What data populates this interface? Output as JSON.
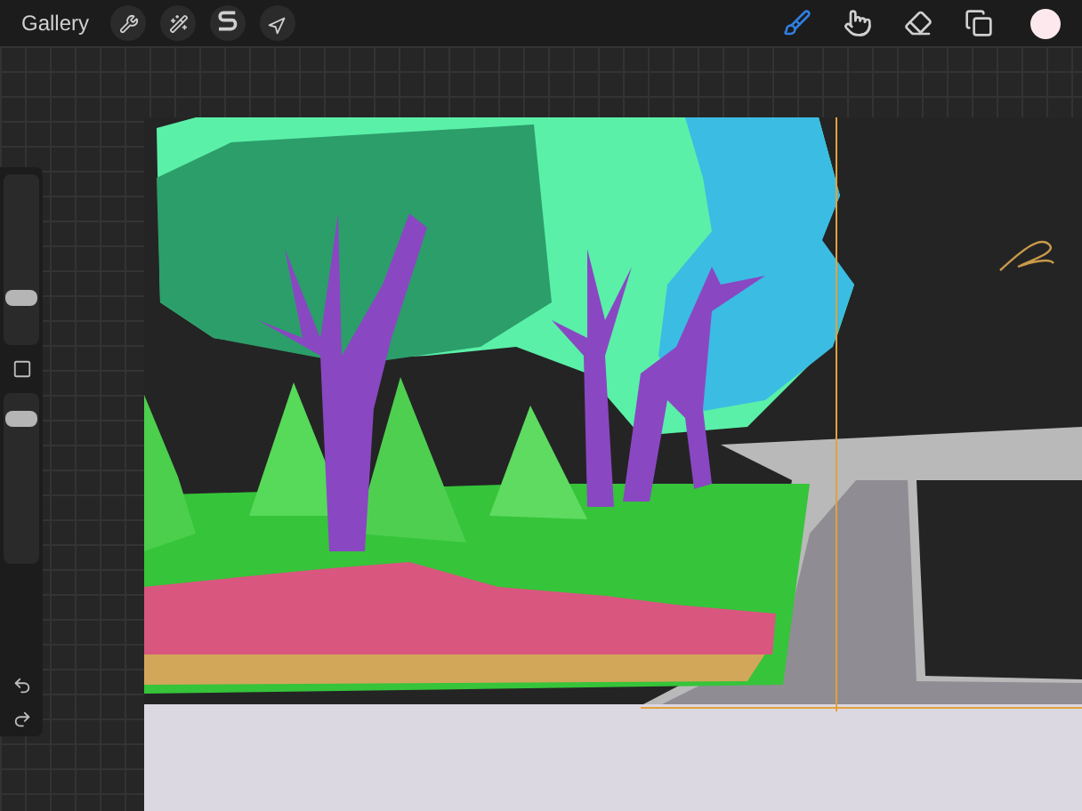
{
  "toolbar": {
    "gallery": "Gallery",
    "actions": [
      {
        "kind": "settings"
      },
      {
        "kind": "adjust"
      },
      {
        "kind": "select"
      },
      {
        "kind": "transform"
      }
    ],
    "tools": [
      {
        "kind": "brush",
        "selected": true
      },
      {
        "kind": "smudge",
        "selected": false
      },
      {
        "kind": "eraser",
        "selected": false
      },
      {
        "kind": "layers",
        "selected": false
      }
    ],
    "color": "#fde8ee"
  },
  "sidebar": {
    "size": {
      "level": 0.25
    },
    "opacity": {
      "level": 0.88
    }
  }
}
